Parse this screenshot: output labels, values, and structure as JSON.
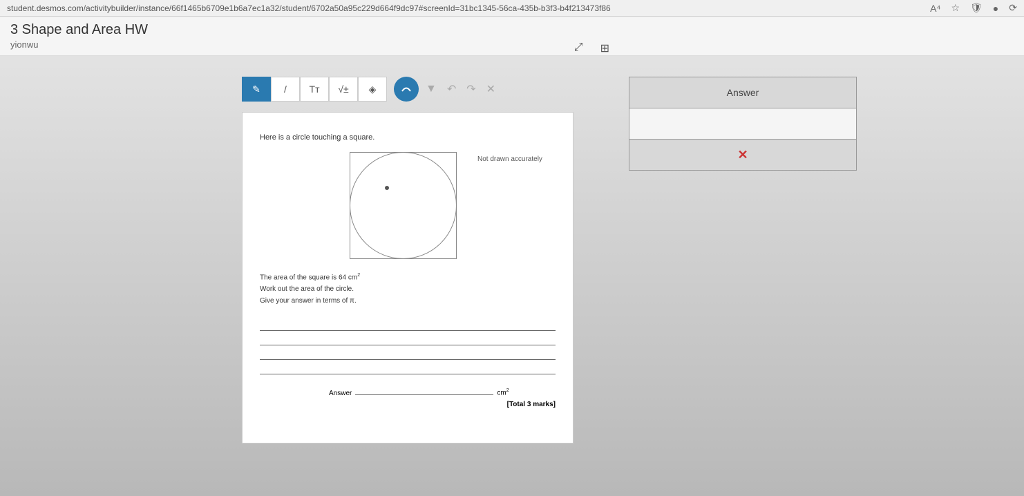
{
  "url": "student.desmos.com/activitybuilder/instance/66f1465b6709e1b6a7ec1a32/student/6702a50a95c229d664f9dc97#screenId=31bc1345-56ca-435b-b3f3-b4f213473f86",
  "title": "3 Shape and Area HW",
  "username": "yionwu",
  "toolbar": {
    "pen": "✎",
    "line": "/",
    "text": "Tт",
    "math": "√±",
    "eraser": "◈",
    "undo": "↶",
    "redo": "↷",
    "clear": "✕",
    "dropdown": "▼"
  },
  "question": {
    "intro": "Here is a circle touching a square.",
    "not_drawn": "Not drawn accurately",
    "line1": "The area of the square is 64 cm",
    "line1_sup": "2",
    "line2": "Work out the area of the circle.",
    "line3": "Give your answer in terms of π.",
    "answer_label": "Answer",
    "unit": "cm",
    "unit_sup": "2",
    "total": "[Total 3 marks]"
  },
  "answer_panel": {
    "header": "Answer",
    "mark": "✕"
  },
  "browser": {
    "read_aloud": "A⁴",
    "star": "☆"
  }
}
